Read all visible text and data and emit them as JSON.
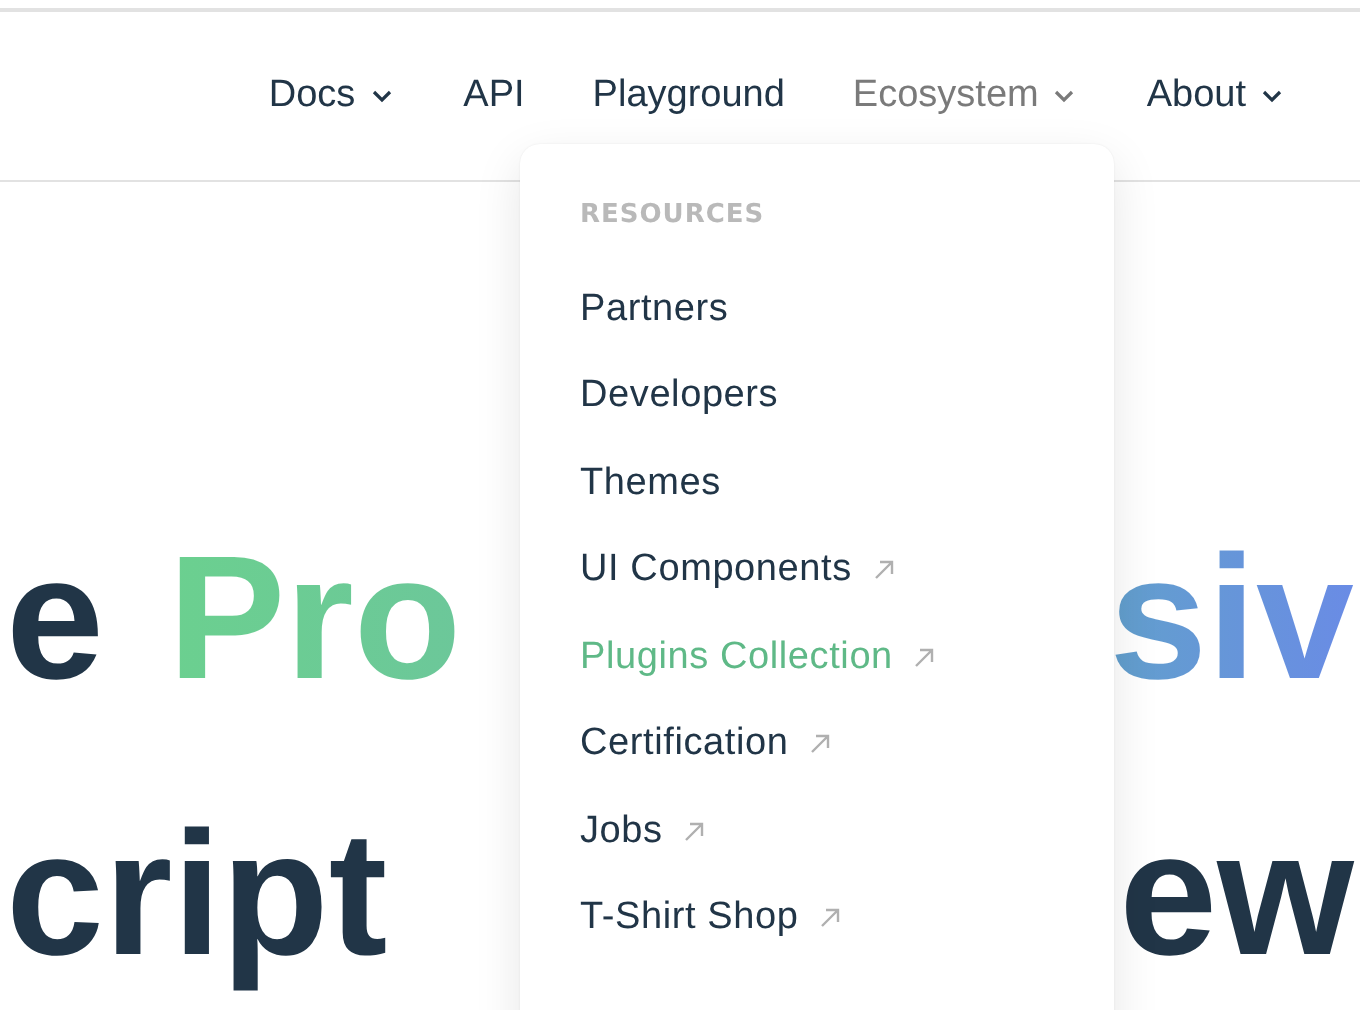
{
  "nav": {
    "items": [
      {
        "label": "Docs",
        "has_menu": true,
        "expanded": false
      },
      {
        "label": "API",
        "has_menu": false,
        "expanded": false
      },
      {
        "label": "Playground",
        "has_menu": false,
        "expanded": false
      },
      {
        "label": "Ecosystem",
        "has_menu": true,
        "expanded": true
      },
      {
        "label": "About",
        "has_menu": true,
        "expanded": false
      }
    ]
  },
  "dropdown": {
    "section_title": "RESOURCES",
    "items": [
      {
        "label": "Partners",
        "external": false,
        "active": false
      },
      {
        "label": "Developers",
        "external": false,
        "active": false
      },
      {
        "label": "Themes",
        "external": false,
        "active": false
      },
      {
        "label": "UI Components",
        "external": true,
        "active": false
      },
      {
        "label": "Plugins Collection",
        "external": true,
        "active": true
      },
      {
        "label": "Certification",
        "external": true,
        "active": false
      },
      {
        "label": "Jobs",
        "external": true,
        "active": false
      },
      {
        "label": "T-Shirt Shop",
        "external": true,
        "active": false
      }
    ]
  },
  "hero": {
    "lines": [
      {
        "left": [
          {
            "text": "e",
            "kind": "plain"
          },
          {
            "text": "Pro",
            "kind": "green"
          }
        ],
        "right": [
          {
            "text": "siv",
            "kind": "blue"
          }
        ]
      },
      {
        "left": [
          {
            "text": "cript",
            "kind": "plain"
          }
        ],
        "right": [
          {
            "text": "ew",
            "kind": "plain"
          }
        ]
      }
    ]
  }
}
